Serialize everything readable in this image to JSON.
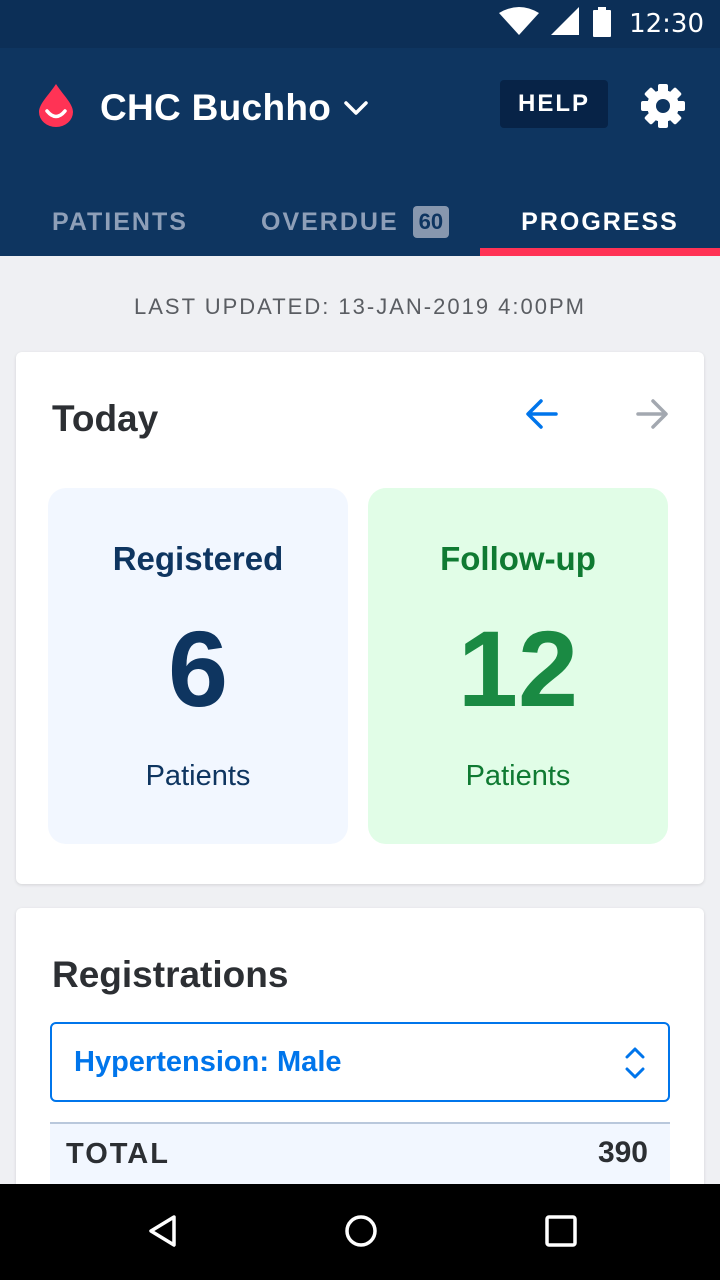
{
  "status_bar": {
    "time": "12:30",
    "icons": [
      "wifi-icon",
      "cell-signal-icon",
      "battery-icon"
    ]
  },
  "header": {
    "facility_name": "CHC Buchho",
    "help_label": "HELP",
    "icons": [
      "blood-drop-logo-icon",
      "chevron-down-icon",
      "gear-icon"
    ]
  },
  "tabs": [
    {
      "label": "PATIENTS",
      "active": false
    },
    {
      "label": "OVERDUE",
      "badge": "60",
      "active": false
    },
    {
      "label": "PROGRESS",
      "active": true
    }
  ],
  "last_updated": "LAST UPDATED: 13-JAN-2019 4:00PM",
  "today_card": {
    "title": "Today",
    "registered": {
      "label": "Registered",
      "value": "6",
      "unit": "Patients"
    },
    "followup": {
      "label": "Follow-up",
      "value": "12",
      "unit": "Patients"
    }
  },
  "registrations_card": {
    "title": "Registrations",
    "select_value": "Hypertension: Male",
    "total_label": "TOTAL",
    "total_value": "390"
  },
  "colors": {
    "header_bg": "#0e3560",
    "status_bg": "#0c2f57",
    "accent_red": "#ff3355",
    "link_blue": "#0075eb",
    "registered_bg": "#f2f7ff",
    "followup_bg": "#e1fde7",
    "followup_green": "#1a8a43"
  }
}
